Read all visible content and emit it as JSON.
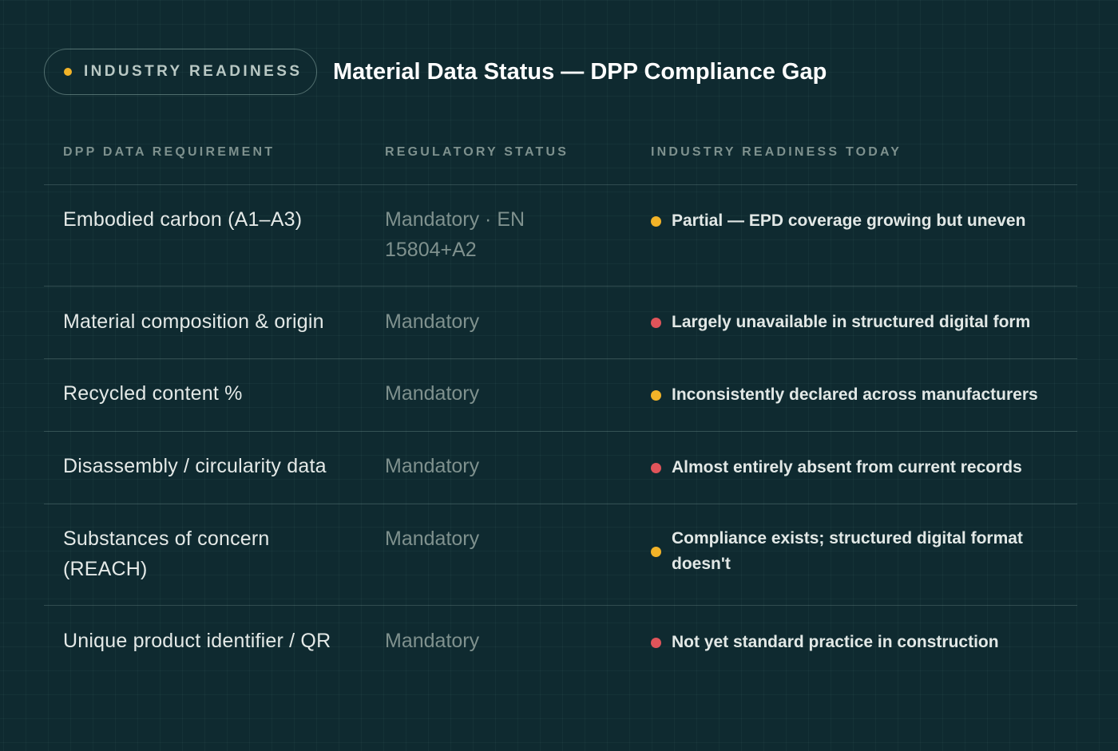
{
  "header": {
    "badge_label": "INDUSTRY READINESS",
    "title": "Material Data Status — DPP Compliance Gap"
  },
  "colors": {
    "background": "#0f2a30",
    "partial": "#f2b328",
    "unavailable": "#e0545a"
  },
  "table": {
    "columns": [
      "DPP DATA REQUIREMENT",
      "REGULATORY STATUS",
      "INDUSTRY READINESS TODAY"
    ],
    "rows": [
      {
        "requirement": "Embodied carbon (A1–A3)",
        "status": "Mandatory · EN 15804+A2",
        "readiness": "Partial — EPD coverage growing but uneven",
        "level": "partial"
      },
      {
        "requirement": "Material composition & origin",
        "status": "Mandatory",
        "readiness": "Largely unavailable in structured digital form",
        "level": "unavailable"
      },
      {
        "requirement": "Recycled content %",
        "status": "Mandatory",
        "readiness": "Inconsistently declared across manufacturers",
        "level": "partial"
      },
      {
        "requirement": "Disassembly / circularity data",
        "status": "Mandatory",
        "readiness": "Almost entirely absent from current records",
        "level": "unavailable"
      },
      {
        "requirement": "Substances of concern (REACH)",
        "status": "Mandatory",
        "readiness": "Compliance exists; structured digital format doesn't",
        "level": "partial"
      },
      {
        "requirement": "Unique product identifier / QR",
        "status": "Mandatory",
        "readiness": "Not yet standard practice in construction",
        "level": "unavailable"
      }
    ]
  }
}
